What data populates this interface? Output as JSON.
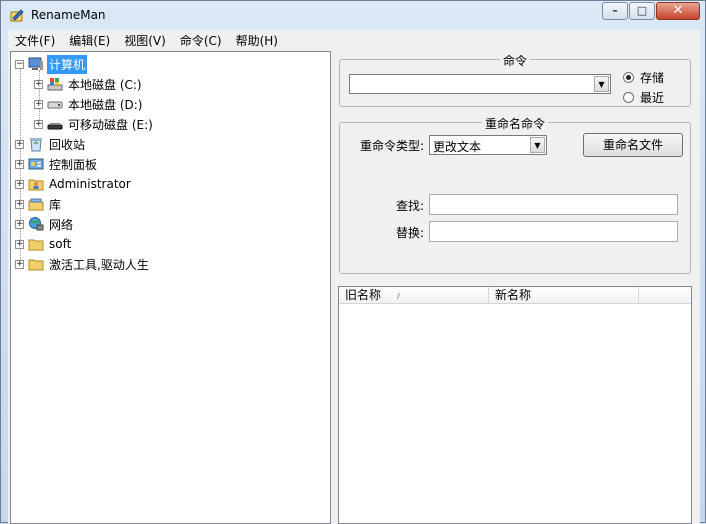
{
  "window": {
    "title": "RenameMan"
  },
  "menu": [
    "文件(F)",
    "编辑(E)",
    "视图(V)",
    "命令(C)",
    "帮助(H)"
  ],
  "tree": {
    "computer": "计算机",
    "drive_c": "本地磁盘 (C:)",
    "drive_d": "本地磁盘 (D:)",
    "drive_e": "可移动磁盘 (E:)",
    "recycle": "回收站",
    "control_panel": "控制面板",
    "administrator": "Administrator",
    "library": "库",
    "network": "网络",
    "soft": "soft",
    "activation": "激活工具,驱动人生"
  },
  "command_group": {
    "title": "命令",
    "combo_value": "",
    "radio_store": "存储",
    "radio_recent": "最近"
  },
  "rename_group": {
    "title": "重命名命令",
    "type_label": "重命令类型:",
    "type_value": "更改文本",
    "rename_button": "重命名文件",
    "find_label": "查找:",
    "find_value": "",
    "replace_label": "替换:",
    "replace_value": ""
  },
  "list": {
    "columns": [
      "旧名称",
      "新名称"
    ]
  },
  "colors": {
    "selection": "#3399ff",
    "close_button": "#c7432b"
  }
}
